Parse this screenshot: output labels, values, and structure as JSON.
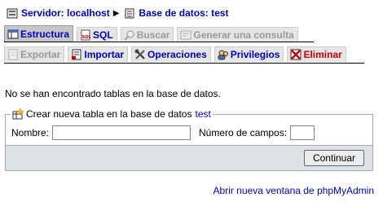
{
  "breadcrumb": {
    "server_label": "Servidor: localhost",
    "database_label": "Base de datos: test"
  },
  "tabs_row1": [
    {
      "label": "Estructura",
      "icon": "structure-icon",
      "state": "active"
    },
    {
      "label": "SQL",
      "icon": "sql-icon",
      "state": "link"
    },
    {
      "label": "Buscar",
      "icon": "search-icon",
      "state": "disabled"
    },
    {
      "label": "Generar una consulta",
      "icon": "query-icon",
      "state": "disabled"
    }
  ],
  "tabs_row2": [
    {
      "label": "Exportar",
      "icon": "export-icon",
      "state": "disabled"
    },
    {
      "label": "Importar",
      "icon": "import-icon",
      "state": "link"
    },
    {
      "label": "Operaciones",
      "icon": "operations-icon",
      "state": "link"
    },
    {
      "label": "Privilegios",
      "icon": "privileges-icon",
      "state": "link"
    },
    {
      "label": "Eliminar",
      "icon": "drop-icon",
      "state": "danger"
    }
  ],
  "message": "No se han encontrado tablas en la base de datos.",
  "create_table": {
    "legend": "Crear nueva tabla en la base de datos",
    "db_link": "test",
    "name_label": "Nombre:",
    "name_value": "",
    "fields_label": "Número de campos:",
    "fields_value": "",
    "submit_label": "Continuar"
  },
  "footer_link": "Abrir nueva ventana de phpMyAdmin",
  "colors": {
    "link": "#0000cc",
    "danger": "#cc0000",
    "tab_bg": "#e5e5e5",
    "tab_active_bg": "#c6c6c6",
    "form_footer_bg": "#dde2e6"
  }
}
